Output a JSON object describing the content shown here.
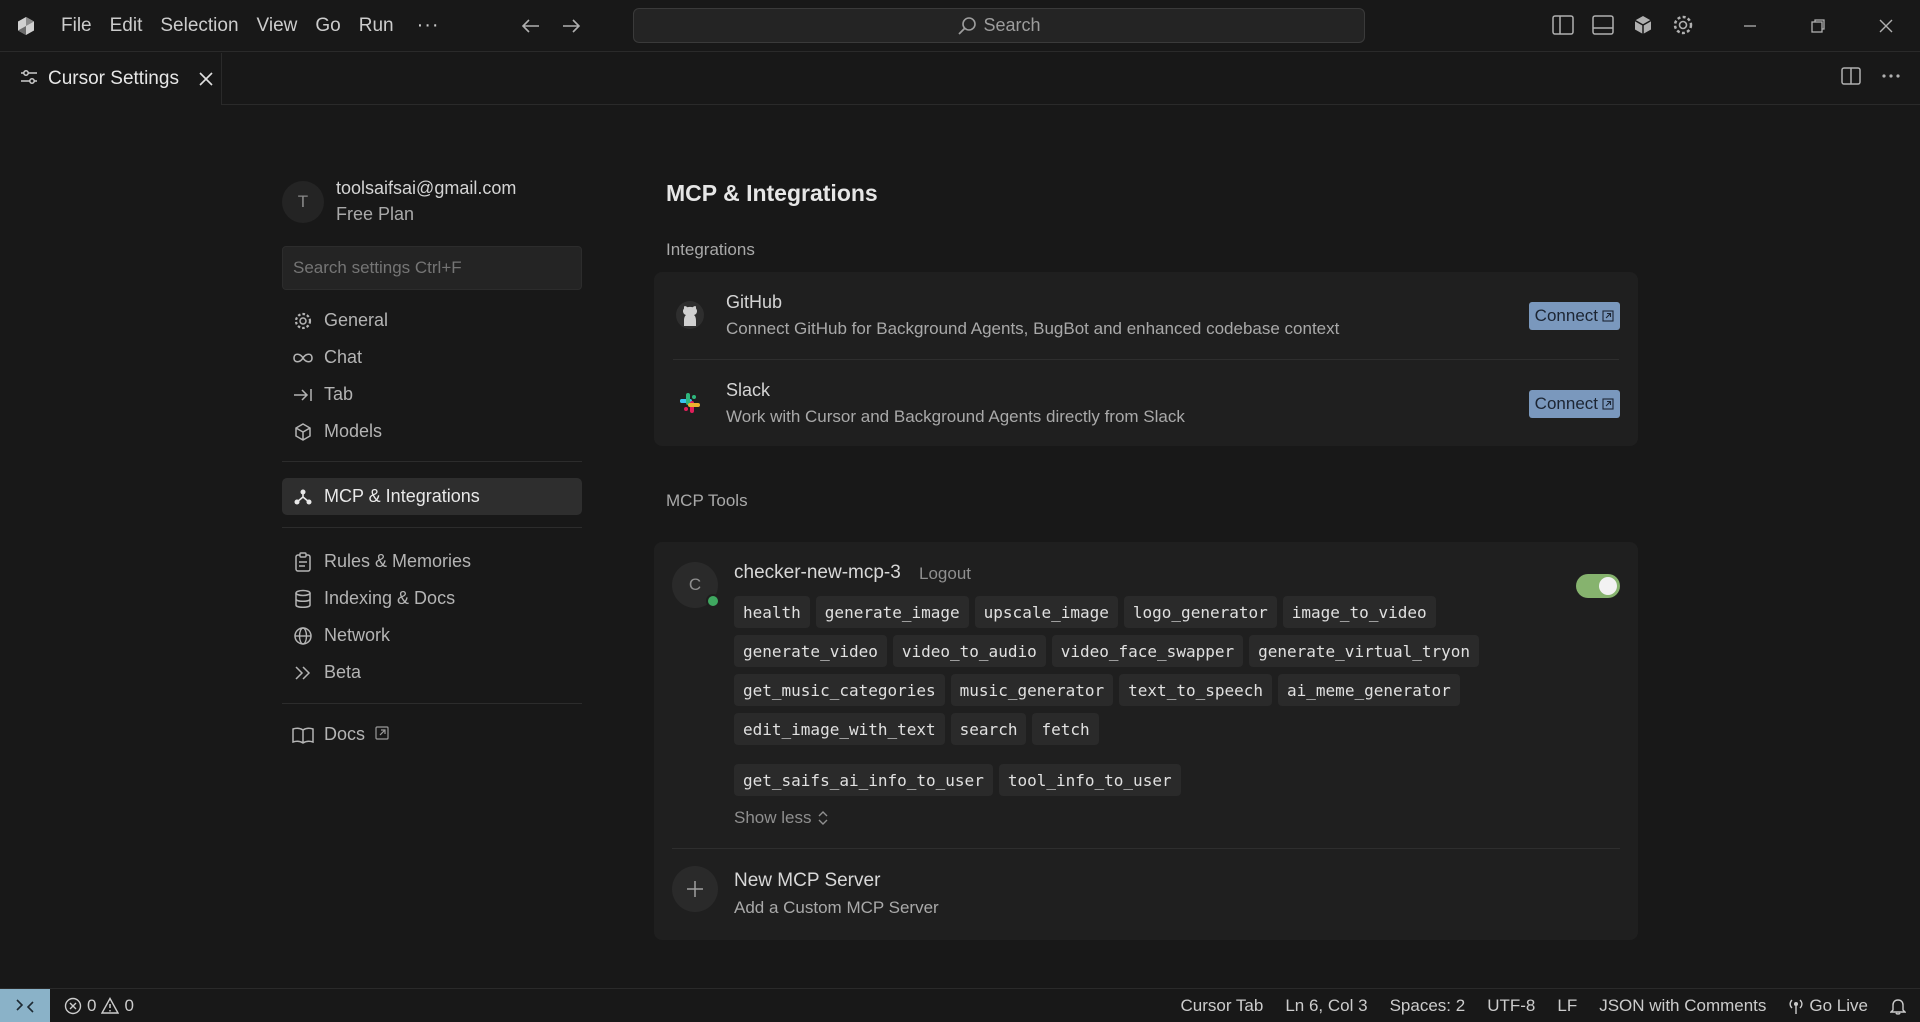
{
  "menu": {
    "items": [
      "File",
      "Edit",
      "Selection",
      "View",
      "Go",
      "Run"
    ],
    "more": "···"
  },
  "search": {
    "label": "Search"
  },
  "tab": {
    "label": "Cursor Settings"
  },
  "account": {
    "initial": "T",
    "email": "toolsaifsai@gmail.com",
    "plan": "Free Plan"
  },
  "settings_search": {
    "placeholder": "Search settings Ctrl+F"
  },
  "nav": {
    "group1": [
      {
        "label": "General",
        "icon": "gear-icon"
      },
      {
        "label": "Chat",
        "icon": "infinity-icon"
      },
      {
        "label": "Tab",
        "icon": "arrow-right-bar-icon"
      },
      {
        "label": "Models",
        "icon": "cube-icon"
      }
    ],
    "group2": [
      {
        "label": "MCP & Integrations",
        "icon": "nodes-icon",
        "active": true
      }
    ],
    "group3": [
      {
        "label": "Rules & Memories",
        "icon": "clipboard-icon"
      },
      {
        "label": "Indexing & Docs",
        "icon": "database-icon"
      },
      {
        "label": "Network",
        "icon": "globe-icon"
      },
      {
        "label": "Beta",
        "icon": "chevrons-right-icon"
      }
    ],
    "group4": [
      {
        "label": "Docs",
        "icon": "book-icon"
      }
    ]
  },
  "main": {
    "title": "MCP & Integrations",
    "integrations_label": "Integrations",
    "integrations": [
      {
        "name": "GitHub",
        "description": "Connect GitHub for Background Agents, BugBot and enhanced codebase context",
        "action": "Connect"
      },
      {
        "name": "Slack",
        "description": "Work with Cursor and Background Agents directly from Slack",
        "action": "Connect"
      }
    ],
    "mcp_label": "MCP Tools",
    "server": {
      "initial": "C",
      "name": "checker-new-mcp-3",
      "logout": "Logout",
      "enabled": true,
      "tool_rows": [
        [
          "health",
          "generate_image",
          "upscale_image",
          "logo_generator",
          "image_to_video"
        ],
        [
          "generate_video",
          "video_to_audio",
          "video_face_swapper",
          "generate_virtual_tryon"
        ],
        [
          "get_music_categories",
          "music_generator",
          "text_to_speech",
          "ai_meme_generator"
        ],
        [
          "edit_image_with_text",
          "search",
          "fetch"
        ],
        [
          "get_saifs_ai_info_to_user",
          "tool_info_to_user"
        ]
      ],
      "show_less": "Show less"
    },
    "new_server": {
      "title": "New MCP Server",
      "subtitle": "Add a Custom MCP Server"
    }
  },
  "statusbar": {
    "errors": "0",
    "warnings": "0",
    "items": [
      "Cursor Tab",
      "Ln 6, Col 3",
      "Spaces: 2",
      "UTF-8",
      "LF",
      "JSON with Comments"
    ],
    "go_live": "Go Live"
  },
  "colors": {
    "accent_button": "#7a98bd",
    "toggle_on": "#86b36e",
    "status_online": "#3fa860",
    "remote": "#8ab2c8"
  }
}
